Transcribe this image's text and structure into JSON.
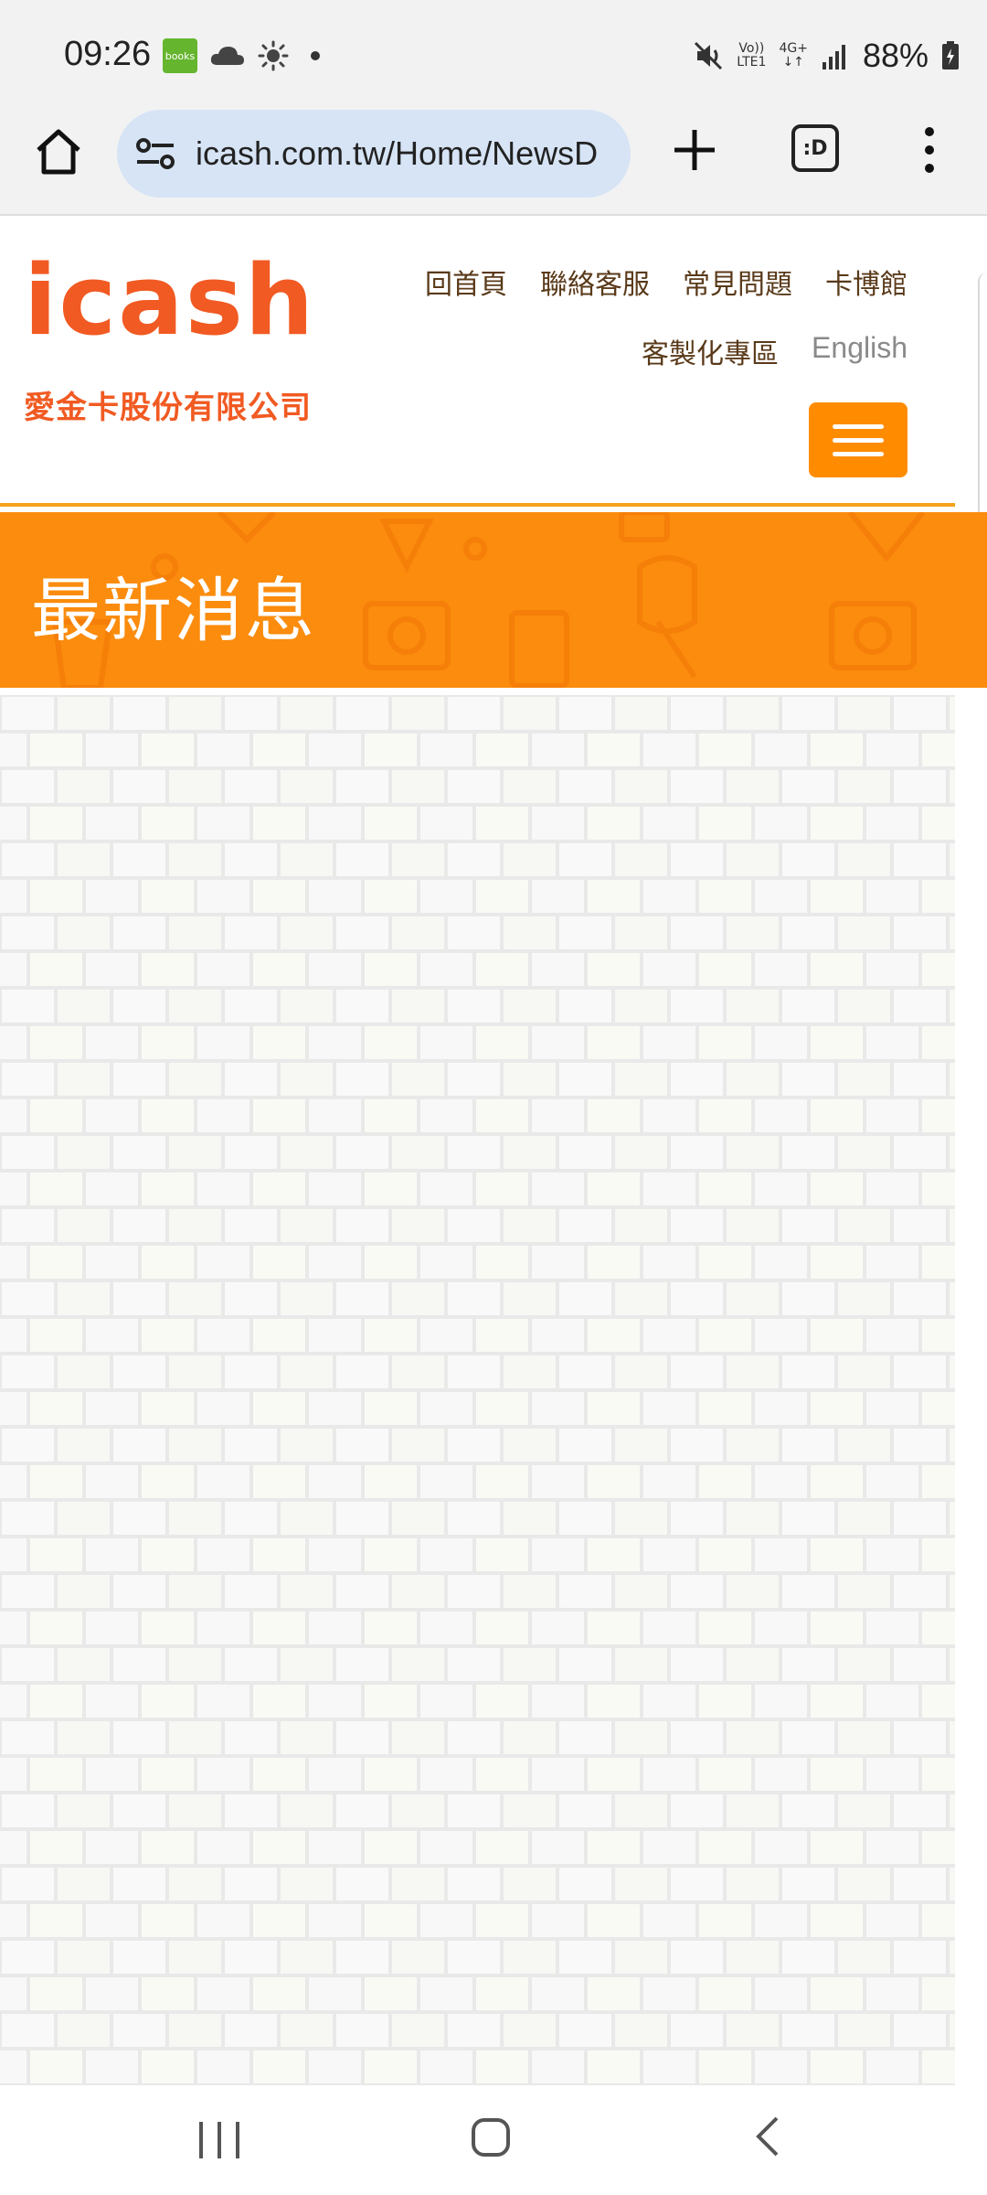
{
  "status_bar": {
    "time": "09:26",
    "books_label": "books",
    "volte_label": "Vo))\nLTE1",
    "network_label": "4G+",
    "battery": "88%"
  },
  "browser": {
    "url": "icash.com.tw/Home/NewsD",
    "tabs_label": ":D"
  },
  "site": {
    "logo_word": "icash",
    "logo_sub": "愛金卡股份有限公司",
    "nav_row1": [
      "回首頁",
      "聯絡客服",
      "常見問題",
      "卡博館"
    ],
    "nav_row2": [
      "客製化專區",
      "English"
    ],
    "accent_color": "#fb8c0d",
    "logo_color": "#f15a22"
  },
  "banner": {
    "title": "最新消息"
  }
}
